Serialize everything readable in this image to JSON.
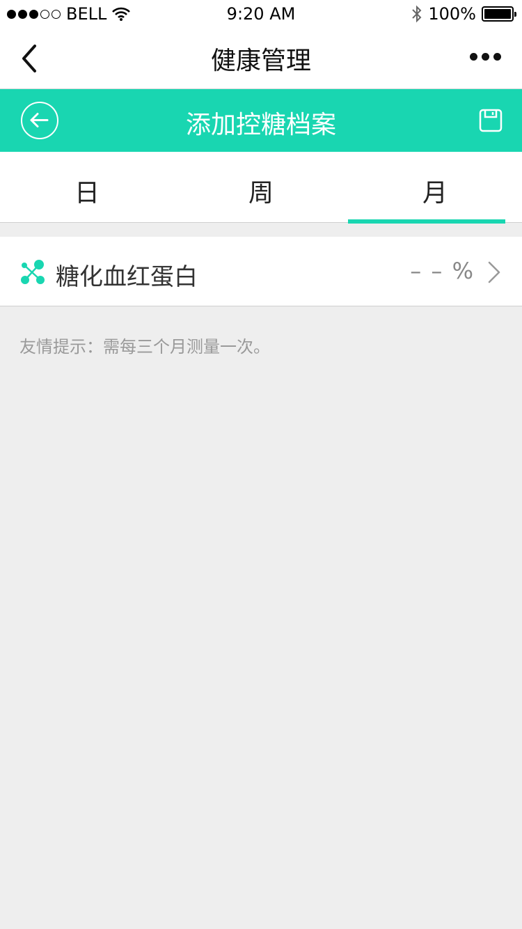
{
  "status_bar": {
    "carrier": "BELL",
    "time": "9:20 AM",
    "battery": "100%"
  },
  "nav": {
    "title": "健康管理"
  },
  "header": {
    "title": "添加控糖档案"
  },
  "tabs": [
    {
      "label": "日"
    },
    {
      "label": "周"
    },
    {
      "label": "月"
    }
  ],
  "record": {
    "label": "糖化血红蛋白",
    "value": "– – %"
  },
  "tip": "友情提示：需每三个月测量一次。",
  "colors": {
    "accent": "#19d6b1"
  },
  "icons": [
    "back-chevron-icon",
    "more-icon",
    "circle-back-icon",
    "save-icon",
    "molecule-icon",
    "chevron-right-icon",
    "wifi-icon",
    "bluetooth-icon"
  ]
}
